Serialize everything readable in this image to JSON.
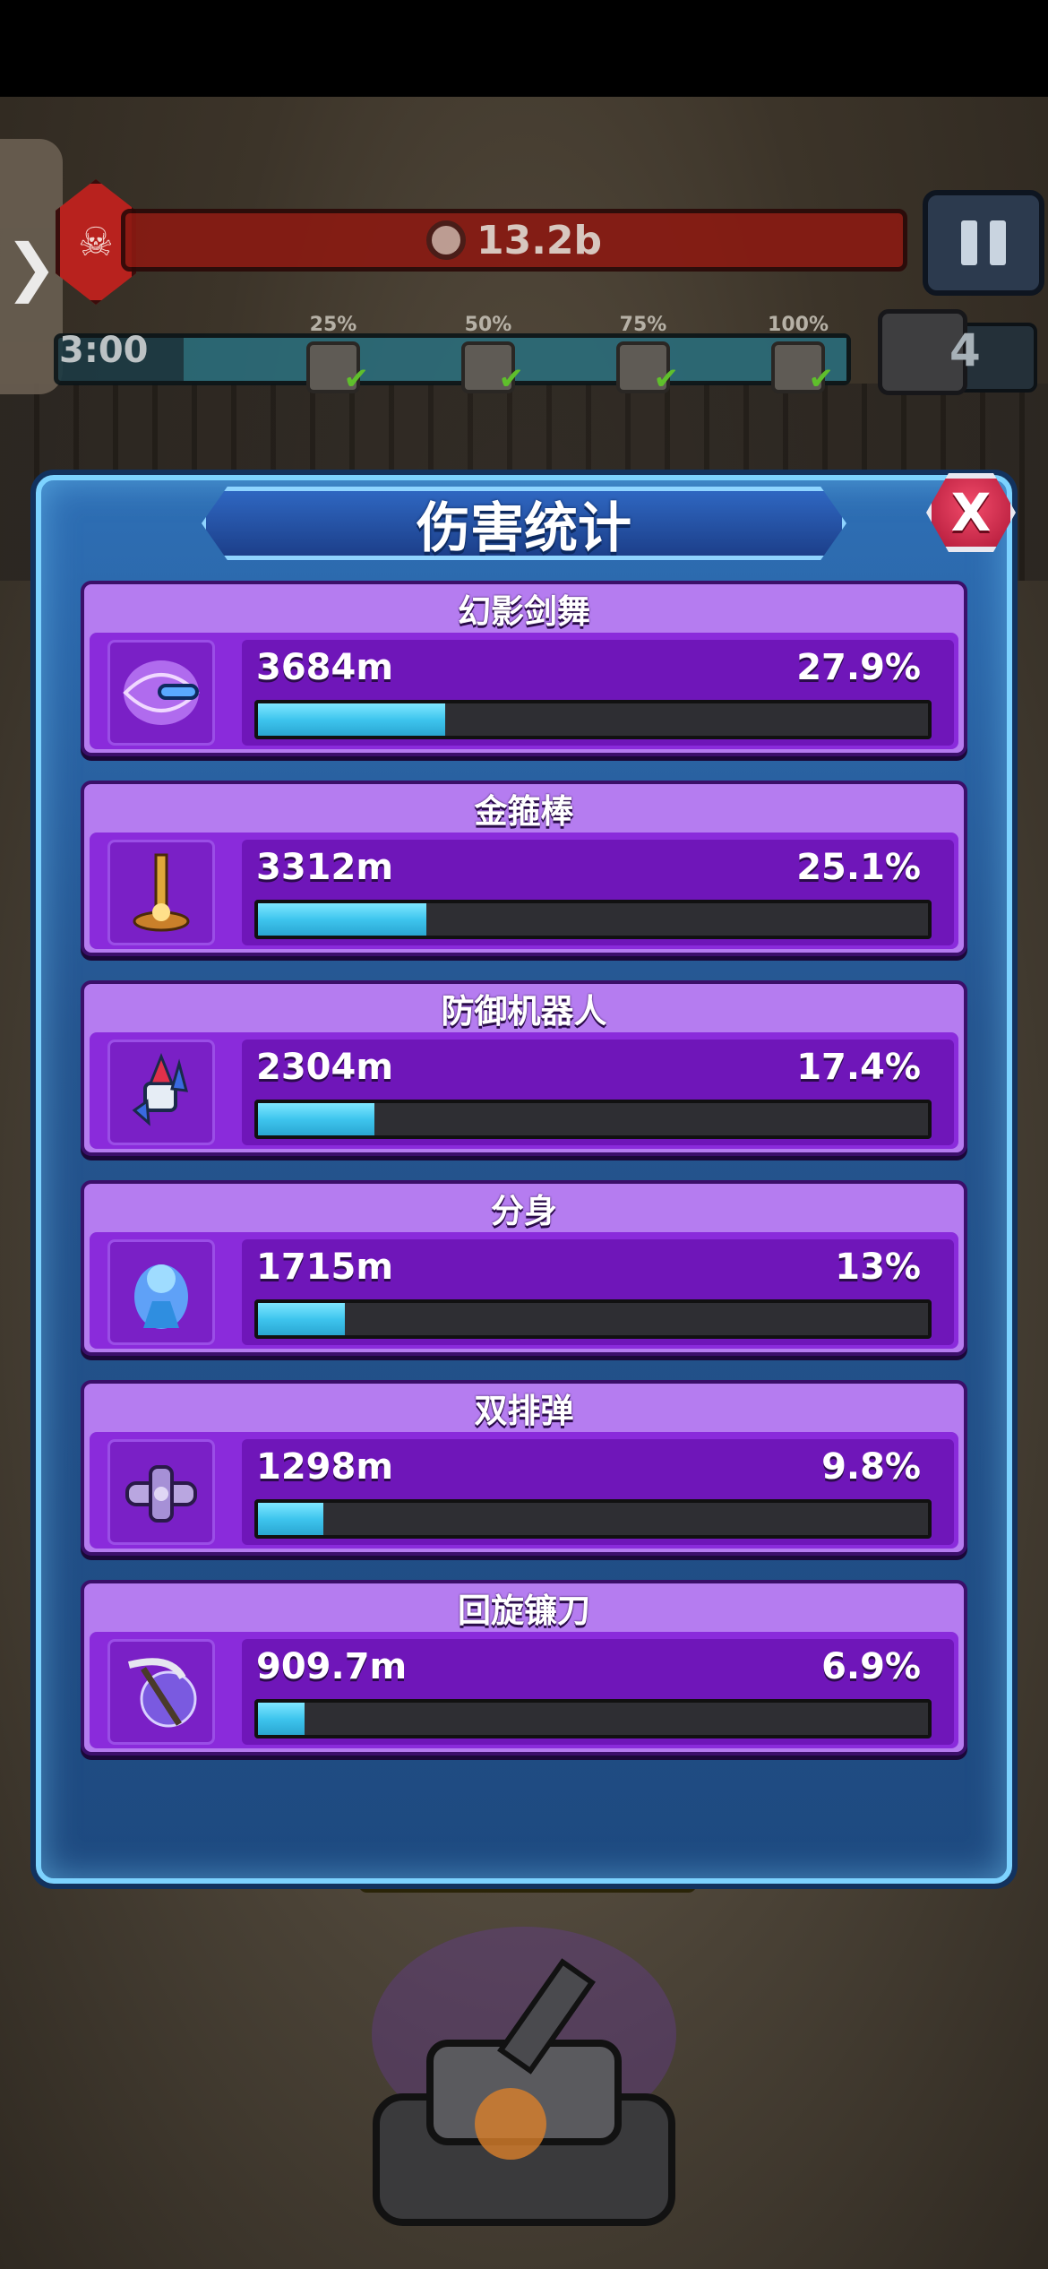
{
  "hud": {
    "boss_hp": "13.2b",
    "timer": "3:00",
    "milestones": [
      "25%",
      "50%",
      "75%",
      "100%"
    ],
    "coin_count": "4"
  },
  "panel": {
    "title": "伤害统计",
    "close_label": "X"
  },
  "skills": [
    {
      "name": "幻影剑舞",
      "damage": "3684m",
      "percent": "27.9%",
      "share": 0.279,
      "icon": "phantom-sword-icon",
      "color": "#7fe7ff"
    },
    {
      "name": "金箍棒",
      "damage": "3312m",
      "percent": "25.1%",
      "share": 0.251,
      "icon": "golden-staff-icon",
      "color": "#7fe7ff"
    },
    {
      "name": "防御机器人",
      "damage": "2304m",
      "percent": "17.4%",
      "share": 0.174,
      "icon": "defense-robot-icon",
      "color": "#7fe7ff"
    },
    {
      "name": "分身",
      "damage": "1715m",
      "percent": "13%",
      "share": 0.13,
      "icon": "clone-icon",
      "color": "#7fe7ff"
    },
    {
      "name": "双排弹",
      "damage": "1298m",
      "percent": "9.8%",
      "share": 0.098,
      "icon": "double-shot-icon",
      "color": "#7fe7ff"
    },
    {
      "name": "回旋镰刀",
      "damage": "909.7m",
      "percent": "6.9%",
      "share": 0.069,
      "icon": "boomerang-scythe-icon",
      "color": "#7fe7ff"
    }
  ]
}
